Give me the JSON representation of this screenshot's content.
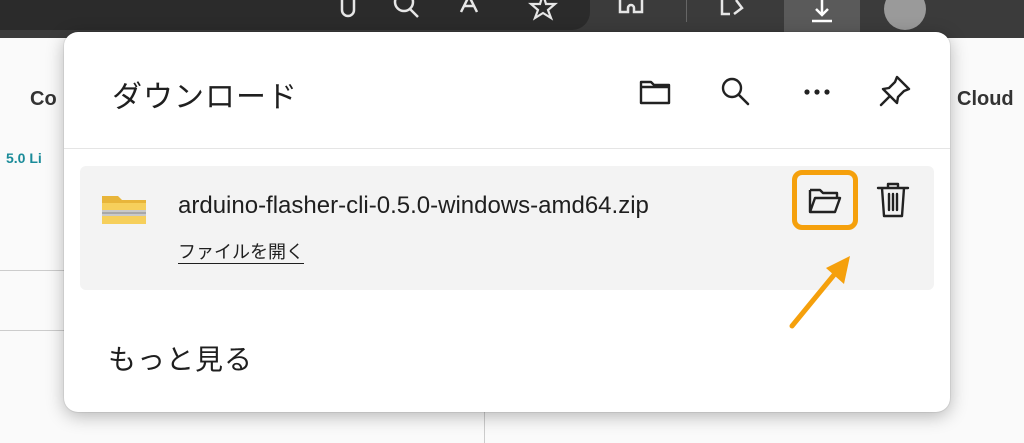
{
  "panel": {
    "title": "ダウンロード",
    "header_icons": [
      "folder-icon",
      "search-icon",
      "more-options-icon",
      "pin-icon"
    ],
    "download": {
      "filename": "arduino-flasher-cli-0.5.0-windows-amd64.zip",
      "open_file_label": "ファイルを開く",
      "icon": "zip-folder-icon"
    },
    "see_more_label": "もっと見る"
  },
  "background": {
    "left_heading": "Co",
    "left_link": "5.0 Li",
    "right_heading": "Cloud"
  },
  "colors": {
    "highlight": "#f5a00c",
    "toolbar": "#3b3b3b"
  }
}
